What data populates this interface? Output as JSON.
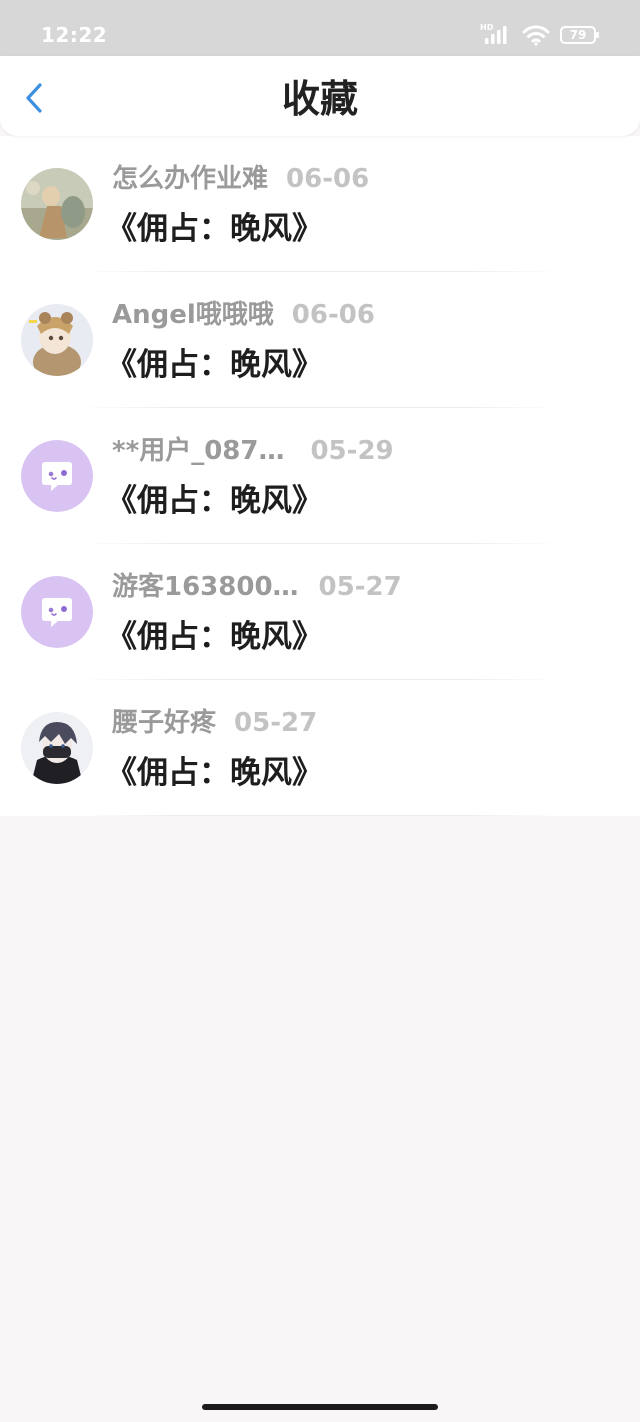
{
  "status_bar": {
    "time": "12:22",
    "network": "HD",
    "battery": "79",
    "icons": [
      "signal-icon",
      "wifi-icon",
      "battery-icon"
    ]
  },
  "header": {
    "title": "收藏",
    "back_icon": "chevron-left-icon",
    "accent_color": "#3d8fe0"
  },
  "favorites": [
    {
      "username": "怎么办作业难",
      "date": "06-06",
      "title": "《佣占：晚风》",
      "avatar": "image-avatar"
    },
    {
      "username": "Angel哦哦哦",
      "date": "06-06",
      "title": "《佣占：晚风》",
      "avatar": "image-avatar"
    },
    {
      "username": "**用户_087…",
      "date": "05-29",
      "title": "《佣占：晚风》",
      "avatar": "default-chat-avatar"
    },
    {
      "username": "游客163800…",
      "date": "05-27",
      "title": "《佣占：晚风》",
      "avatar": "default-chat-avatar"
    },
    {
      "username": "腰子好疼",
      "date": "05-27",
      "title": "《佣占：晚风》",
      "avatar": "image-avatar"
    }
  ],
  "colors": {
    "avatar_default_bg": "#d9c3f3",
    "username": "#9a9a9a",
    "date": "#c3c3c3",
    "title": "#1e1e1e"
  }
}
